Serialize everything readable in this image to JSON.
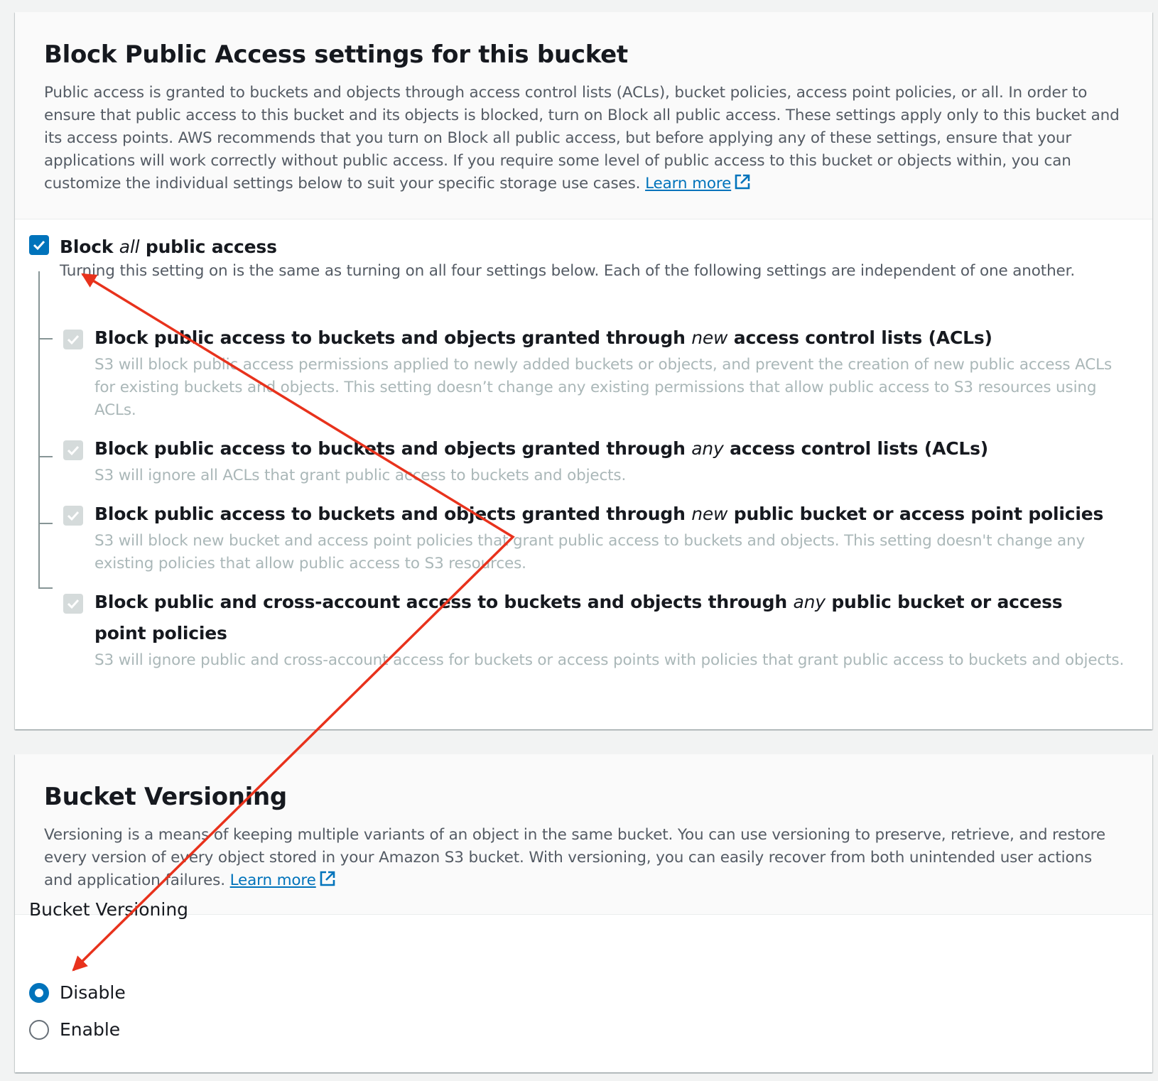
{
  "block_public_access": {
    "title": "Block Public Access settings for this bucket",
    "description": "Public access is granted to buckets and objects through access control lists (ACLs), bucket policies, access point policies, or all. In order to ensure that public access to this bucket and its objects is blocked, turn on Block all public access. These settings apply only to this bucket and its access points. AWS recommends that you turn on Block all public access, but before applying any of these settings, ensure that your applications will work correctly without public access. If you require some level of public access to this bucket or objects within, you can customize the individual settings below to suit your specific storage use cases.",
    "learn_more": "Learn more",
    "block_all": {
      "label_pre": "Block ",
      "label_em": "all",
      "label_post": " public access",
      "checked": true,
      "description": "Turning this setting on is the same as turning on all four settings below. Each of the following settings are independent of one another."
    },
    "settings": [
      {
        "label_pre": "Block public access to buckets and objects granted through ",
        "label_em": "new",
        "label_post": " access control lists (ACLs)",
        "checked": true,
        "disabled": true,
        "description": "S3 will block public access permissions applied to newly added buckets or objects, and prevent the creation of new public access ACLs for existing buckets and objects. This setting doesn’t change any existing permissions that allow public access to S3 resources using ACLs."
      },
      {
        "label_pre": "Block public access to buckets and objects granted through ",
        "label_em": "any",
        "label_post": " access control lists (ACLs)",
        "checked": true,
        "disabled": true,
        "description": "S3 will ignore all ACLs that grant public access to buckets and objects."
      },
      {
        "label_pre": "Block public access to buckets and objects granted through ",
        "label_em": "new",
        "label_post": " public bucket or access point policies",
        "checked": true,
        "disabled": true,
        "description": "S3 will block new bucket and access point policies that grant public access to buckets and objects. This setting doesn't change any existing policies that allow public access to S3 resources."
      },
      {
        "label_pre": "Block public and cross-account access to buckets and objects through ",
        "label_em": "any",
        "label_post": " public bucket or access point policies",
        "checked": true,
        "disabled": true,
        "description": "S3 will ignore public and cross-account access for buckets or access points with policies that grant public access to buckets and objects."
      }
    ]
  },
  "bucket_versioning": {
    "title": "Bucket Versioning",
    "description": "Versioning is a means of keeping multiple variants of an object in the same bucket. You can use versioning to preserve, retrieve, and restore every version of every object stored in your Amazon S3 bucket. With versioning, you can easily recover from both unintended user actions and application failures.",
    "learn_more": "Learn more",
    "field_label": "Bucket Versioning",
    "options": [
      {
        "label": "Disable",
        "selected": true
      },
      {
        "label": "Enable",
        "selected": false
      }
    ]
  },
  "colors": {
    "accent": "#0073bb",
    "annotation": "#e8321c",
    "disabled_text": "#aab7b8"
  }
}
